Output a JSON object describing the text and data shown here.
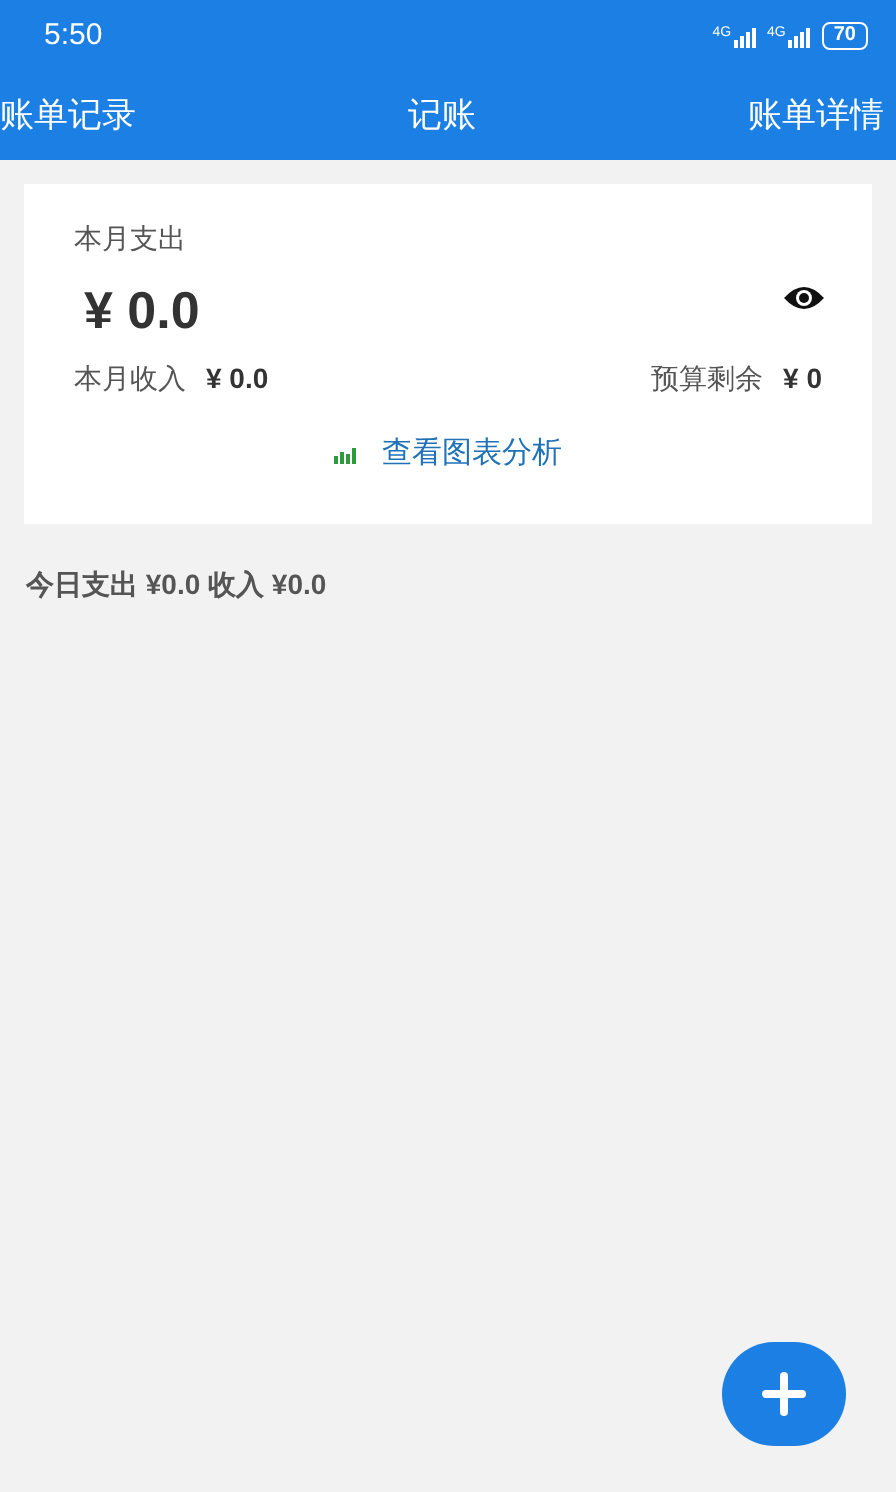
{
  "status_bar": {
    "time": "5:50",
    "networks": [
      "4G",
      "4G"
    ],
    "battery": "70"
  },
  "nav": {
    "left": "账单记录",
    "title": "记账",
    "right": "账单详情"
  },
  "summary": {
    "expense_label": "本月支出",
    "expense": "¥ 0.0",
    "income_label": "本月收入",
    "income": "¥ 0.0",
    "budget_label": "预算剩余",
    "budget": "¥ 0",
    "chart_link": "查看图表分析"
  },
  "today": "今日支出 ¥0.0 收入 ¥0.0"
}
